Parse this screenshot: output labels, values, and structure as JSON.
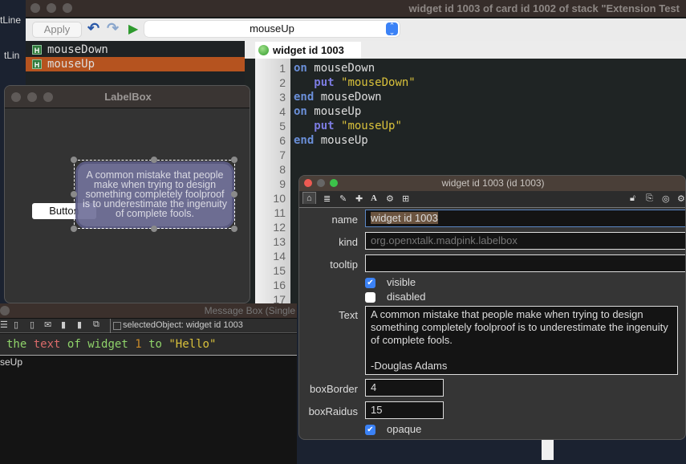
{
  "background_fragments": [
    "tLine",
    "tLin",
    "s",
    "n",
    "o",
    "s",
    "o",
    "\"",
    "e",
    "n",
    "r",
    "l"
  ],
  "script_editor": {
    "title": "widget id 1003 of card id 1002 of stack \"Extension Test",
    "apply_label": "Apply",
    "handler_select": "mouseUp",
    "handlers": [
      {
        "label": "mouseDown",
        "badge": "H"
      },
      {
        "label": "mouseUp",
        "badge": "H",
        "selected": true
      }
    ],
    "tab_label": "widget id 1003",
    "line_numbers": [
      "1",
      "2",
      "3",
      "4",
      "5",
      "6",
      "7",
      "8",
      "9",
      "10",
      "11",
      "12",
      "13",
      "14",
      "15",
      "16",
      "17"
    ],
    "code": [
      {
        "kw": "on",
        "rest": " mouseDown"
      },
      {
        "indent": "   ",
        "kw": "put",
        "str": " \"mouseDown\""
      },
      {
        "kw": "end",
        "rest": " mouseDown"
      },
      {
        "kw": "on",
        "rest": " mouseUp"
      },
      {
        "indent": "   ",
        "kw": "put",
        "str": " \"mouseUp\""
      },
      {
        "kw": "end",
        "rest": " mouseUp"
      }
    ],
    "accent_selected": "#b5531f"
  },
  "labelbox_window": {
    "title": "LabelBox",
    "button_label": "Button",
    "widget_text": "A common mistake that people make when trying to design something completely foolproof is to underestimate the ingenuity of complete fools.",
    "widget_fill": "#72729a"
  },
  "message_box": {
    "title": "Message Box (Single",
    "selected_object": "selectedObject: widget id 1003",
    "command": {
      "p1": "the",
      "p2": "text",
      "p3": "of",
      "p4": "widget",
      "p5": "1",
      "p6": "to",
      "p7": "\"Hello\""
    },
    "output": "seUp"
  },
  "inspector": {
    "title": "widget id 1003 (id 1003)",
    "fields": {
      "name_label": "name",
      "name_value": "widget id 1003",
      "kind_label": "kind",
      "kind_value": "org.openxtalk.madpink.labelbox",
      "tooltip_label": "tooltip",
      "tooltip_value": "",
      "visible_label": "visible",
      "visible": true,
      "disabled_label": "disabled",
      "disabled": false,
      "text_label": "Text",
      "text_lines": [
        "A common mistake that people make when trying to design",
        "something completely foolproof is to underestimate the ingenuity",
        "of complete fools.",
        "",
        "-Douglas Adams"
      ],
      "boxborder_label": "boxBorder",
      "boxborder_value": "4",
      "boxradius_label": "boxRaidus",
      "boxradius_value": "15",
      "opaque_label": "opaque",
      "opaque": true
    }
  }
}
